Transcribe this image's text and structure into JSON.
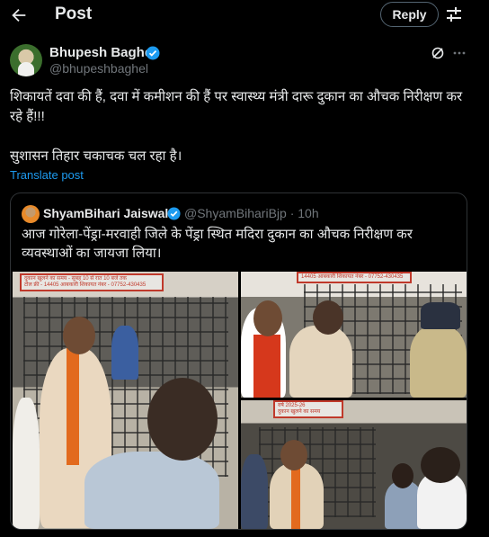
{
  "header": {
    "title": "Post",
    "reply_label": "Reply"
  },
  "author": {
    "name": "Bhupesh Baghel",
    "handle": "@bhupeshbaghel"
  },
  "post": {
    "text": "शिकायतें दवा की हैं, दवा में कमीशन की हैं पर स्वास्थ्य मंत्री दारू दुकान का औचक निरीक्षण कर रहे हैं!!!\n\nसुशासन तिहार चकाचक चल रहा है।",
    "translate_label": "Translate post"
  },
  "quote": {
    "name": "ShyamBihari Jaiswal",
    "handle": "@ShyamBihariBjp",
    "separator": "·",
    "time": "10h",
    "text": "आज गोरेला-पेंड्रा-मरवाही जिले के पेंड्रा स्थित मदिरा दुकान का औचक निरीक्षण कर व्यवस्थाओं का जायजा लिया।"
  },
  "photos": {
    "sign_1": "दुकान खुलने का समय - सुबह 10 से रात 10 बजे तक",
    "sign_2": "टोल फ्री - 14405  आबकारी शिकायत नंबर - 07752-430435",
    "sign_3": "14405  आबकारी शिकायत नंबर - 07752-430435",
    "sign_4": "वर्ष 2025-26",
    "sign_5": "दुकान खुलने का समय"
  },
  "colors": {
    "accent": "#1d9bf0",
    "muted": "#71767b",
    "border": "#2f3336"
  }
}
